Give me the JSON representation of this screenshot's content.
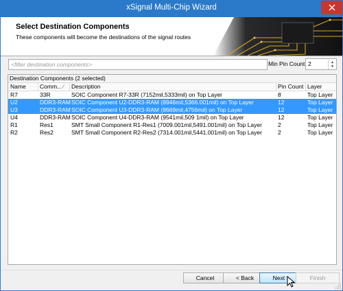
{
  "window": {
    "title": "xSignal Multi-Chip Wizard",
    "title_bar_color": "#2b79c9",
    "close_color": "#c7372f"
  },
  "header": {
    "title": "Select Destination Components",
    "subtitle": "These components will become the destinations of the signal routes"
  },
  "filter": {
    "placeholder": "<filter destination components>",
    "value": ""
  },
  "min_pin": {
    "label": "Min Pin Count:",
    "value": "2"
  },
  "table": {
    "group_label": "Destination Components (2 selected)",
    "columns": [
      "Name",
      "Comm...",
      "Description",
      "Pin Count",
      "Layer"
    ],
    "rows": [
      {
        "name": "R7",
        "comment": "33R",
        "description": "SOIC Component R7-33R (7152mil,5333mil) on Top Layer",
        "pin_count": "8",
        "layer": "Top Layer",
        "selected": false
      },
      {
        "name": "U2",
        "comment": "DDR3-RAM",
        "description": "SOIC Component U2-DDR3-RAM (8946mil,5366.001mil) on Top Layer",
        "pin_count": "12",
        "layer": "Top Layer",
        "selected": true
      },
      {
        "name": "U3",
        "comment": "DDR3-RAM",
        "description": "SOIC Component U3-DDR3-RAM (8669mil,4756mil) on Top Layer",
        "pin_count": "12",
        "layer": "Top Layer",
        "selected": true
      },
      {
        "name": "U4",
        "comment": "DDR3-RAM",
        "description": "SOIC Component U4-DDR3-RAM (9541mil,509 1mil) on Top Layer",
        "pin_count": "12",
        "layer": "Top Layer",
        "selected": false
      },
      {
        "name": "R1",
        "comment": "Res1",
        "description": "SMT Small Component R1-Res1 (7009.001mil,5491.001mil) on Top Layer",
        "pin_count": "2",
        "layer": "Top Layer",
        "selected": false
      },
      {
        "name": "R2",
        "comment": "Res2",
        "description": "SMT Small Component R2-Res2 (7314.001mil,5441.001mil) on Top Layer",
        "pin_count": "2",
        "layer": "Top Layer",
        "selected": false
      }
    ],
    "selection_color": "#3399ff"
  },
  "buttons": {
    "cancel": "Cancel",
    "back": "< Back",
    "next": "Next >",
    "finish": "Finish"
  }
}
